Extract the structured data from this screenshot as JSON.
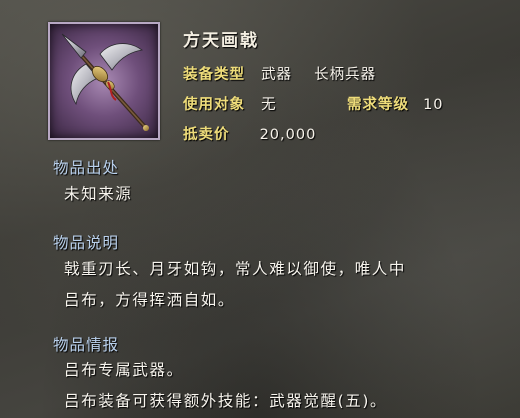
{
  "item": {
    "name": "方天画戟",
    "icon": "halberd-icon",
    "stats": {
      "type_label": "装备类型",
      "type_value": "武器",
      "subtype_value": "长柄兵器",
      "target_label": "使用对象",
      "target_value": "无",
      "level_label": "需求等级",
      "level_value": "10",
      "price_label": "抵卖价",
      "price_value": "20,000"
    }
  },
  "sections": {
    "origin": {
      "title": "物品出处",
      "lines": [
        "未知来源"
      ]
    },
    "description": {
      "title": "物品说明",
      "lines": [
        "戟重刃长、月牙如钩，常人难以御使，唯人中",
        "吕布，方得挥洒自如。"
      ]
    },
    "intel": {
      "title": "物品情报",
      "lines": [
        "吕布专属武器。",
        "吕布装备可获得额外技能：武器觉醒(五)。"
      ]
    }
  },
  "colors": {
    "label": "#eedc7a",
    "section_heading": "#b9d0ec",
    "frame_fill": "#6f4f7b"
  }
}
